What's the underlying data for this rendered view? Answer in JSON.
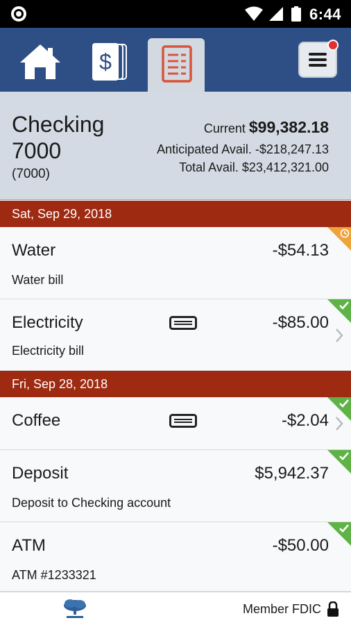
{
  "status_bar": {
    "time": "6:44"
  },
  "nav": {
    "tabs": [
      {
        "name": "home",
        "icon": "home-icon"
      },
      {
        "name": "transfers",
        "icon": "dollar-bills-icon"
      },
      {
        "name": "transactions",
        "icon": "register-icon",
        "active": true
      }
    ],
    "menu_icon": "hamburger-menu-icon",
    "colors": {
      "bar": "#2e4f86",
      "active_tab": "#d3d9e0",
      "notification": "#e23030"
    }
  },
  "account": {
    "name": "Checking 7000",
    "number": "(7000)",
    "current_label": "Current",
    "current_value": "$99,382.18",
    "anticipated_label": "Anticipated Avail.",
    "anticipated_value": "-$218,247.13",
    "total_label": "Total Avail.",
    "total_value": "$23,412,321.00"
  },
  "groups": [
    {
      "date": "Sat, Sep 29, 2018",
      "transactions": [
        {
          "title": "Water",
          "subtitle": "Water bill",
          "amount": "-$54.13",
          "status": "pending"
        },
        {
          "title": "Electricity",
          "subtitle": "Electricity bill",
          "amount": "-$85.00",
          "status": "cleared",
          "has_card": true,
          "has_detail": true
        }
      ]
    },
    {
      "date": "Fri, Sep 28, 2018",
      "transactions": [
        {
          "title": "Coffee",
          "subtitle": "",
          "amount": "-$2.04",
          "status": "cleared",
          "has_card": true,
          "has_detail": true
        },
        {
          "title": "Deposit",
          "subtitle": "Deposit to Checking account",
          "amount": "$5,942.37",
          "status": "cleared"
        },
        {
          "title": "ATM",
          "subtitle": "ATM #1233321",
          "amount": "-$50.00",
          "status": "cleared"
        }
      ]
    }
  ],
  "footer": {
    "member": "Member FDIC",
    "lock_icon": "lock-icon",
    "logo_icon": "bank-tree-logo"
  },
  "colors": {
    "date_header": "#9e2a12",
    "cleared": "#5fb346",
    "pending": "#f0a33a"
  }
}
